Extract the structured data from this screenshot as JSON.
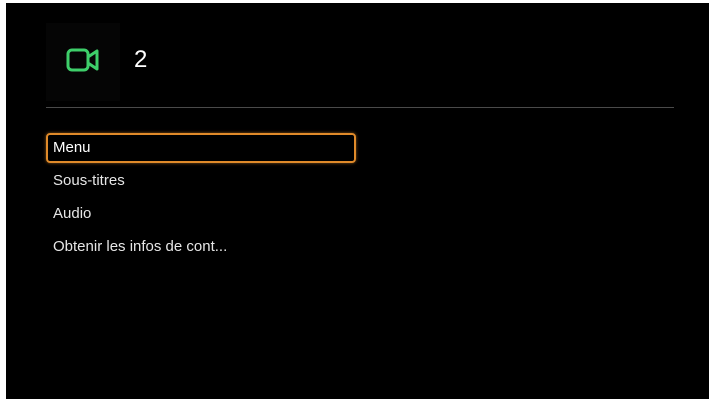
{
  "header": {
    "icon": "video-camera-icon",
    "icon_color": "#3ecf6a",
    "title": "2"
  },
  "menu": {
    "selected_index": 0,
    "highlight_color": "#e08a2a",
    "items": [
      {
        "label": "Menu"
      },
      {
        "label": "Sous-titres"
      },
      {
        "label": "Audio"
      },
      {
        "label": "Obtenir les infos de cont..."
      }
    ]
  }
}
